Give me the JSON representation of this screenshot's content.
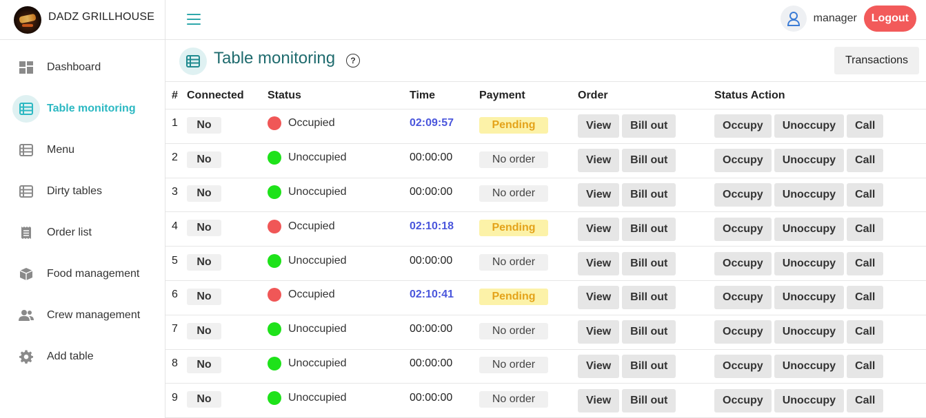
{
  "brand": {
    "name": "DADZ GRILLHOUSE"
  },
  "sidebar": {
    "items": [
      {
        "label": "Dashboard",
        "icon": "dashboard-icon",
        "active": false
      },
      {
        "label": "Table monitoring",
        "icon": "table-list-icon",
        "active": true
      },
      {
        "label": "Menu",
        "icon": "menu-list-icon",
        "active": false
      },
      {
        "label": "Dirty tables",
        "icon": "dirty-tables-icon",
        "active": false
      },
      {
        "label": "Order list",
        "icon": "receipt-icon",
        "active": false
      },
      {
        "label": "Food management",
        "icon": "box-icon",
        "active": false
      },
      {
        "label": "Crew management",
        "icon": "users-icon",
        "active": false
      },
      {
        "label": "Add table",
        "icon": "gear-icon",
        "active": false
      }
    ]
  },
  "header": {
    "user": "manager",
    "logout_label": "Logout"
  },
  "page": {
    "title": "Table monitoring",
    "help": "?",
    "transactions_label": "Transactions"
  },
  "table": {
    "columns": [
      "#",
      "Connected",
      "Status",
      "Time",
      "Payment",
      "Order",
      "Status Action"
    ],
    "order_actions": [
      "View",
      "Bill out"
    ],
    "status_actions": [
      "Occupy",
      "Unoccupy",
      "Call"
    ],
    "rows": [
      {
        "num": "1",
        "connected": "No",
        "status": "Occupied",
        "time": "02:09:57",
        "payment": "Pending"
      },
      {
        "num": "2",
        "connected": "No",
        "status": "Unoccupied",
        "time": "00:00:00",
        "payment": "No order"
      },
      {
        "num": "3",
        "connected": "No",
        "status": "Unoccupied",
        "time": "00:00:00",
        "payment": "No order"
      },
      {
        "num": "4",
        "connected": "No",
        "status": "Occupied",
        "time": "02:10:18",
        "payment": "Pending"
      },
      {
        "num": "5",
        "connected": "No",
        "status": "Unoccupied",
        "time": "00:00:00",
        "payment": "No order"
      },
      {
        "num": "6",
        "connected": "No",
        "status": "Occupied",
        "time": "02:10:41",
        "payment": "Pending"
      },
      {
        "num": "7",
        "connected": "No",
        "status": "Unoccupied",
        "time": "00:00:00",
        "payment": "No order"
      },
      {
        "num": "8",
        "connected": "No",
        "status": "Unoccupied",
        "time": "00:00:00",
        "payment": "No order"
      },
      {
        "num": "9",
        "connected": "No",
        "status": "Unoccupied",
        "time": "00:00:00",
        "payment": "No order"
      }
    ]
  },
  "colors": {
    "accent": "#2bb8c2",
    "occupied": "#f05757",
    "unoccupied": "#1ee21a",
    "time_active": "#4a56dc",
    "pending_bg": "#fcf2a8",
    "pending_text": "#e4a31a",
    "logout": "#f25a5a"
  }
}
